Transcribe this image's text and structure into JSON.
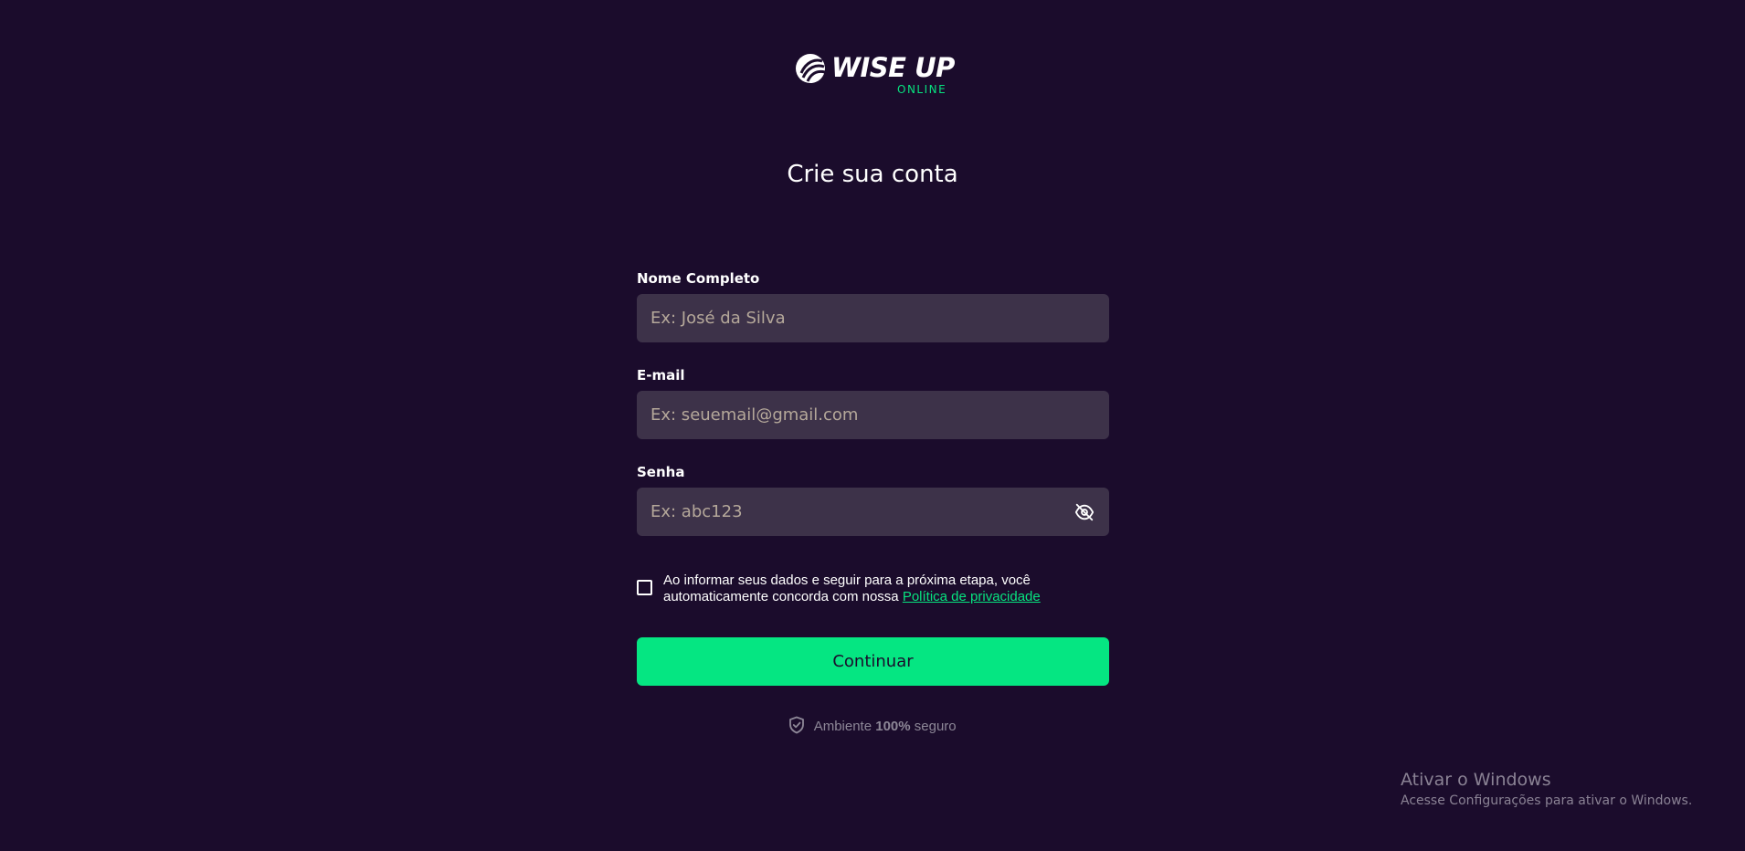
{
  "brand": {
    "name": "WISE UP",
    "subtitle": "ONLINE",
    "accent_color": "#07e37f",
    "background_color": "#1b0c2c"
  },
  "page": {
    "title": "Crie sua conta"
  },
  "form": {
    "name": {
      "label": "Nome Completo",
      "placeholder": "Ex: José da Silva",
      "value": ""
    },
    "email": {
      "label": "E-mail",
      "placeholder": "Ex: seuemail@gmail.com",
      "value": ""
    },
    "password": {
      "label": "Senha",
      "placeholder": "Ex: abc123",
      "value": "",
      "toggle_icon": "eye-off-icon"
    },
    "consent": {
      "checked": false,
      "text_line": "Ao informar seus dados e seguir para a próxima etapa, você automaticamente concorda com nossa",
      "link_label": "Política de privacidade"
    },
    "submit_label": "Continuar"
  },
  "security": {
    "icon": "shield-check-icon",
    "prefix": "Ambiente",
    "highlight": "100%",
    "suffix": "seguro"
  },
  "windows_watermark": {
    "title": "Ativar o Windows",
    "subtitle": "Acesse Configurações para ativar o Windows."
  }
}
